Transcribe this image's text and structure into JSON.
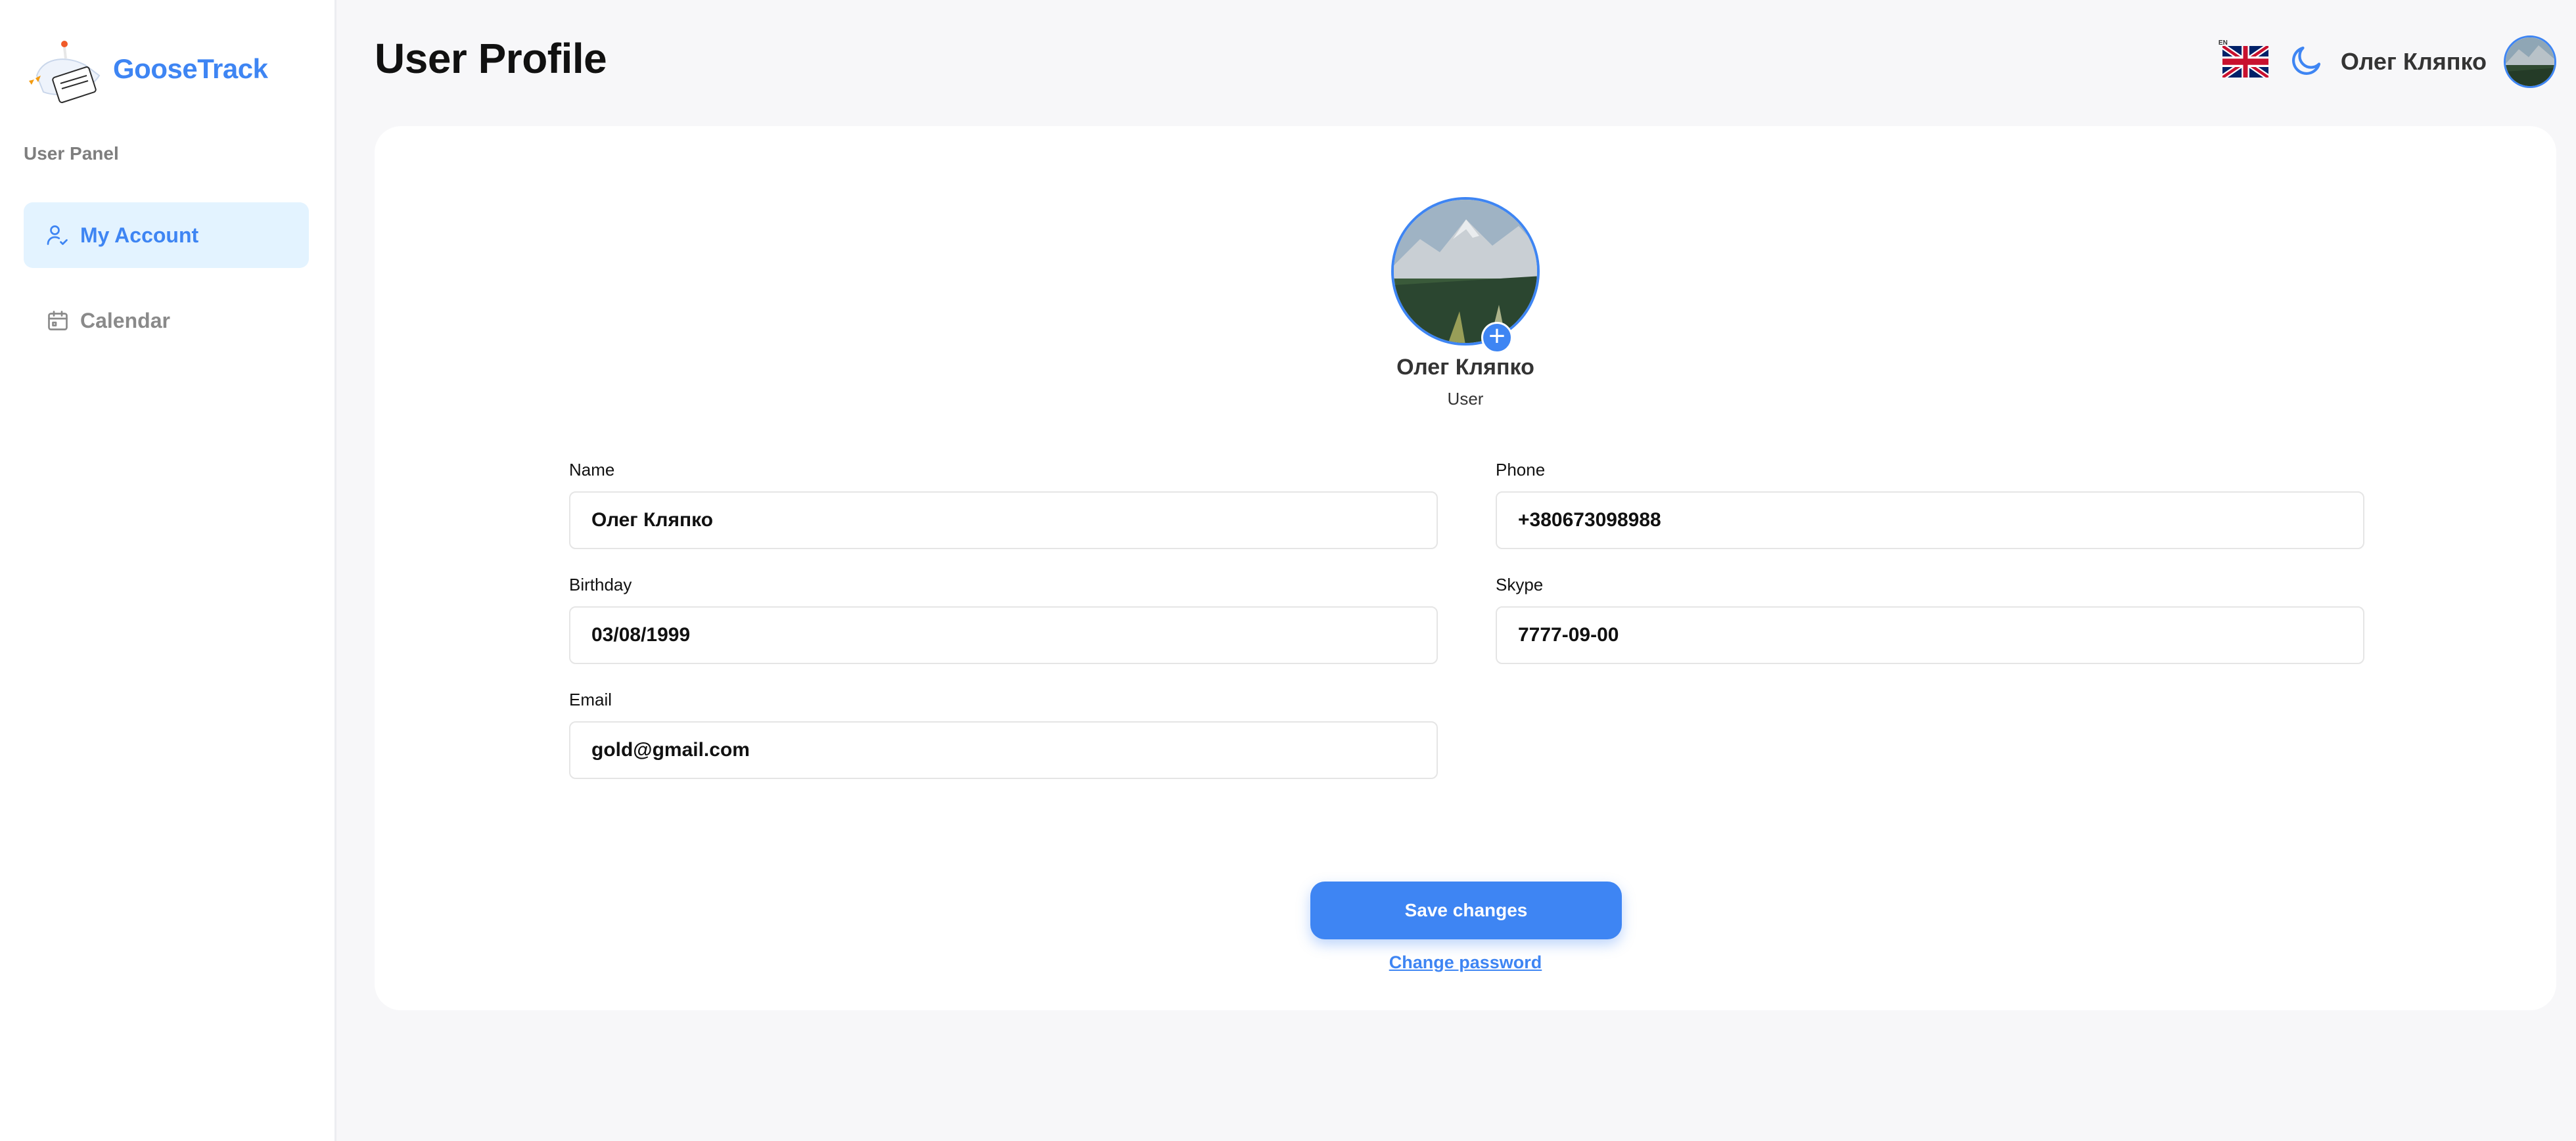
{
  "app": {
    "name": "GooseTrack",
    "accent_color": "#3E85F3"
  },
  "sidebar": {
    "panel_label": "User Panel",
    "items": [
      {
        "label": "My Account",
        "icon": "user-check-icon",
        "active": true
      },
      {
        "label": "Calendar",
        "icon": "calendar-icon",
        "active": false
      }
    ]
  },
  "header": {
    "title": "User Profile",
    "language": "EN",
    "language_icon": "uk-flag-icon",
    "theme_icon": "moon-icon",
    "username": "Олег Кляпко"
  },
  "profile": {
    "name": "Олег Кляпко",
    "role": "User",
    "avatar_action_icon": "plus-icon"
  },
  "form": {
    "name": {
      "label": "Name",
      "value": "Олег Кляпко"
    },
    "phone": {
      "label": "Phone",
      "value": "+380673098988"
    },
    "birthday": {
      "label": "Birthday",
      "value": "03/08/1999"
    },
    "skype": {
      "label": "Skype",
      "value": "7777-09-00"
    },
    "email": {
      "label": "Email",
      "value": "gold@gmail.com"
    },
    "save_label": "Save changes",
    "change_password_label": "Change password"
  }
}
